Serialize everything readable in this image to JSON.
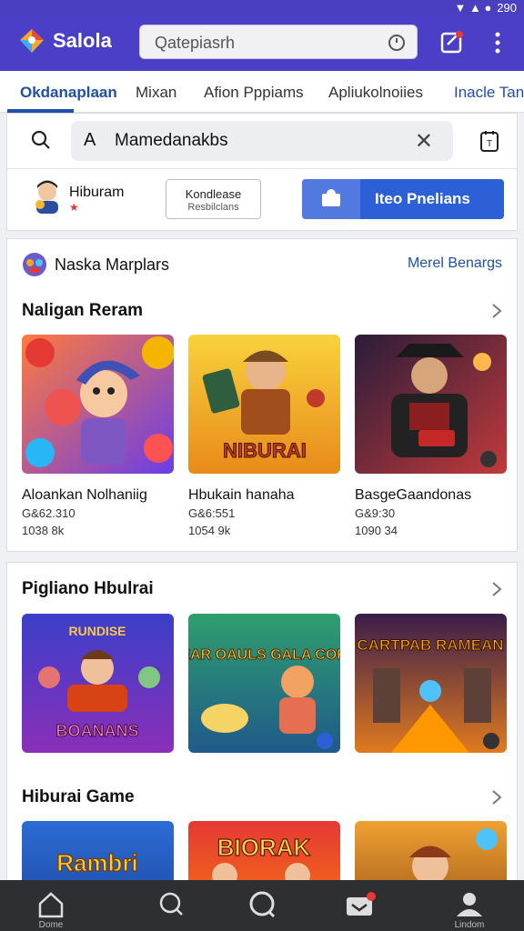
{
  "status_bar": {
    "time": "290"
  },
  "app": {
    "title": "Salola"
  },
  "search_top": {
    "placeholder": "Qatepiasrh"
  },
  "tabs": [
    {
      "label": "Okdanaplaan"
    },
    {
      "label": "Mixan"
    },
    {
      "label": "Afion Pppiams"
    },
    {
      "label": "Apliukolnoiies"
    },
    {
      "label": "Inacle Tan"
    }
  ],
  "search_card": {
    "input_value": "Mamedanakbs",
    "user_name": "Hiburam",
    "outline_button": {
      "line1": "Kondlease",
      "line2": "Resbilclans"
    },
    "primary_button": "Iteo Pnelians"
  },
  "featured": {
    "header": "Naska Marplars",
    "link": "Merel Benargs",
    "row1_title": "Naligan Reram",
    "games": [
      {
        "title": "Aloankan Nolhaniig",
        "sub1": "G&62.310",
        "sub2": "1038 8k"
      },
      {
        "title": "Hbukain hanaha",
        "sub1": "G&6:551",
        "sub2": "1054 9k"
      },
      {
        "title": "BasgeGaandonas",
        "sub1": "G&9:30",
        "sub2": "1090 34"
      }
    ]
  },
  "section2": {
    "row2_title": "Pigliano Hbulrai",
    "row3_title": "Hiburai Game"
  },
  "thumb_text": {
    "row2": [
      "RUNDISE",
      "BOANANS",
      "NEAR OAULS GALA COR!",
      "CARTPAB RAMEAN"
    ],
    "row3": [
      "Rambri",
      "BIORAK"
    ],
    "row1": [
      "NIBURAI"
    ]
  },
  "bottom_nav": [
    {
      "icon": "home-icon",
      "label": "Dome"
    },
    {
      "icon": "search-icon",
      "label": ""
    },
    {
      "icon": "circle-search-icon",
      "label": ""
    },
    {
      "icon": "inbox-icon",
      "label": ""
    },
    {
      "icon": "profile-icon",
      "label": "Lindom"
    }
  ],
  "colors": {
    "brand": "#4b3fc8",
    "accent": "#2d5fd6",
    "link": "#1f4fa8"
  }
}
